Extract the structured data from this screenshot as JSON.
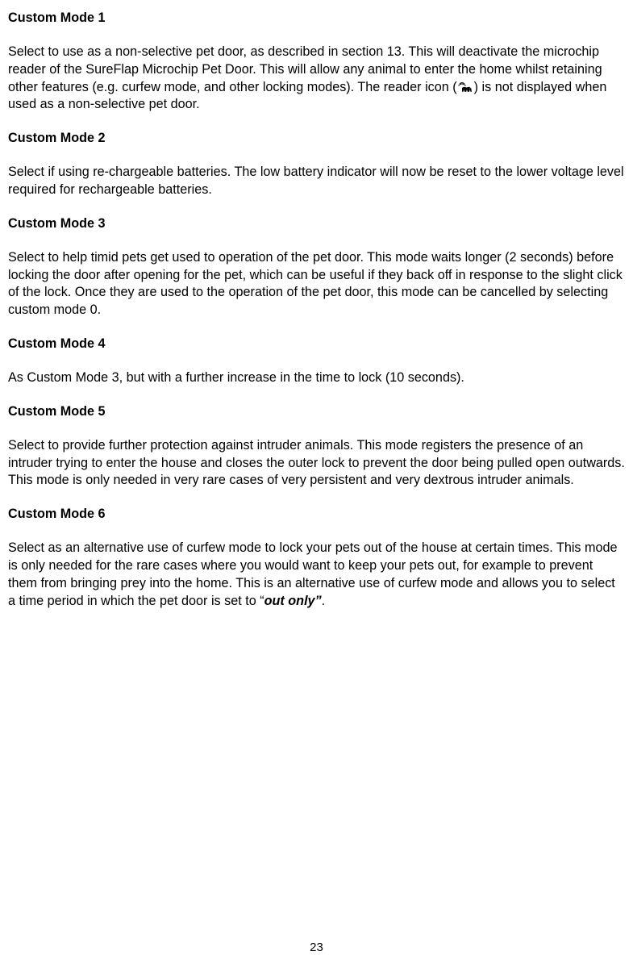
{
  "mode1": {
    "title": "Custom Mode 1",
    "para_a": "Select to use as a non-selective pet door, as described in section 13. This will deactivate the microchip reader of the SureFlap Microchip Pet Door. This will allow any animal to enter the home whilst retaining other features (e.g. curfew mode, and other locking modes). The reader icon (",
    "para_b": ") is not displayed when used as a non-selective pet door."
  },
  "mode2": {
    "title": "Custom Mode 2",
    "para": "Select if using re-chargeable batteries. The low battery indicator will now be reset to the lower voltage level required for rechargeable batteries."
  },
  "mode3": {
    "title": "Custom Mode 3",
    "para": "Select to help timid pets get used to operation of the pet door. This mode waits longer (2 seconds) before locking the door after opening for the pet, which can be useful if they back off in response to the slight click of the lock. Once they are used to the operation of the pet door, this mode can be cancelled by selecting custom mode 0."
  },
  "mode4": {
    "title": "Custom Mode 4",
    "para": "As Custom Mode 3, but with a further increase in the time to lock (10 seconds)."
  },
  "mode5": {
    "title": "Custom Mode 5",
    "para": "Select to provide further protection against intruder animals. This mode registers the presence of an intruder trying to enter the house and closes the outer lock to prevent the door being pulled open outwards. This mode is only needed in very rare cases of very persistent and very dextrous intruder animals."
  },
  "mode6": {
    "title": "Custom Mode 6",
    "para_a": "Select as an alternative use of curfew mode to lock your pets out of the house at certain times. This mode is only needed for the rare cases where you would want to keep your pets out, for example to prevent them from bringing prey into the home. This is an alternative use of curfew mode and allows you to select a time period in which the pet door is set to “",
    "para_bold": "out only”",
    "para_b": "."
  },
  "page_number": "23",
  "icon_name": "reader-icon"
}
